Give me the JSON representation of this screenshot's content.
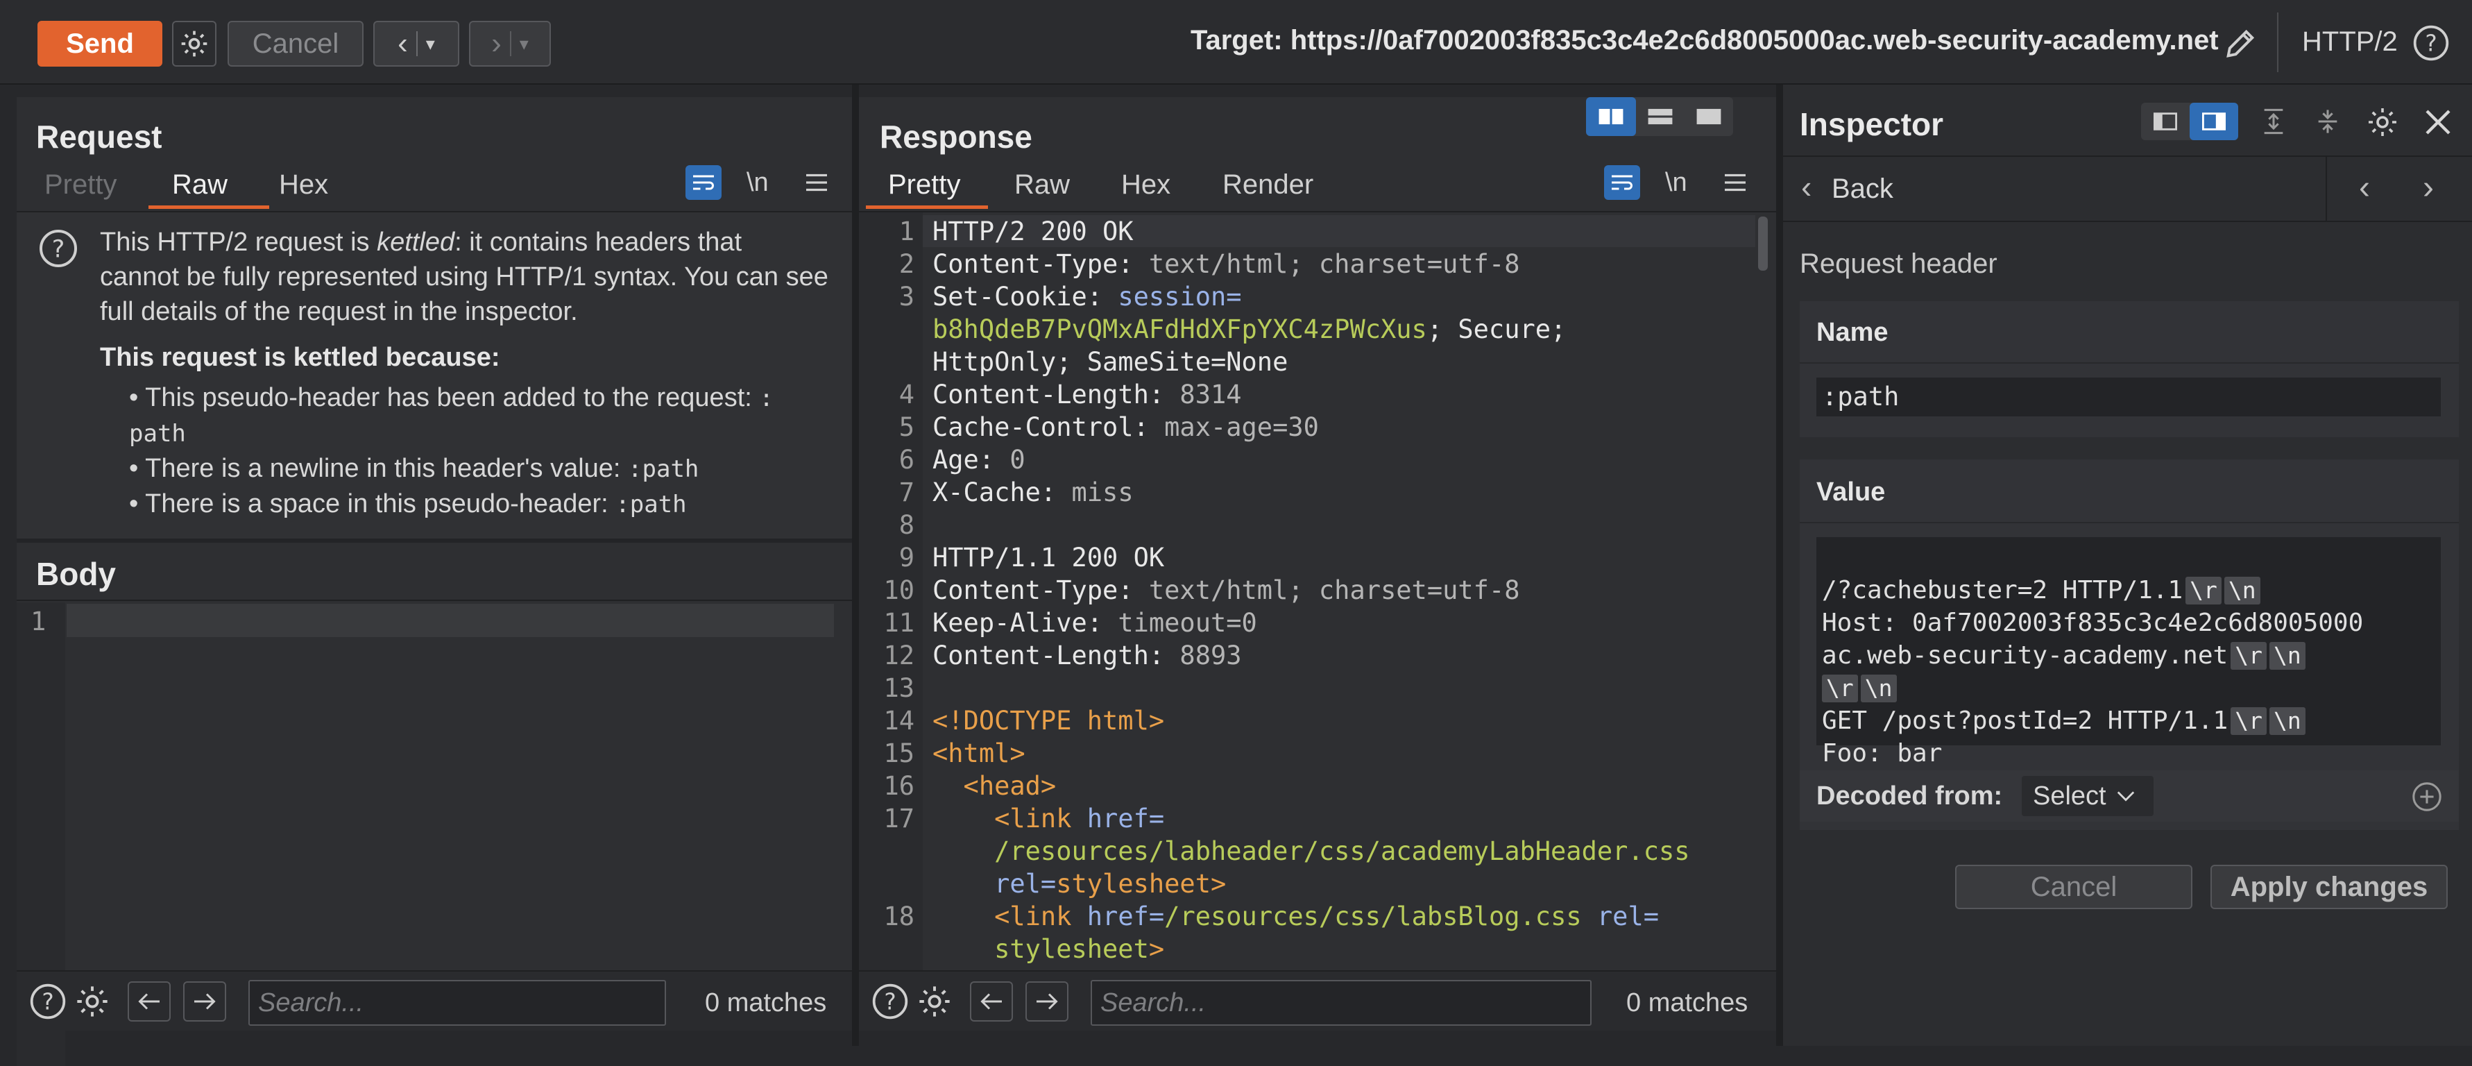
{
  "toolbar": {
    "send_label": "Send",
    "cancel_label": "Cancel",
    "target_label": "Target: https://0af7002003f835c3c4e2c6d8005000ac.web-security-academy.net",
    "protocol_label": "HTTP/2"
  },
  "request": {
    "title": "Request",
    "tabs": [
      "Pretty",
      "Raw",
      "Hex"
    ],
    "newline_toggle": "\\n",
    "kettled_message_1": "This HTTP/2 request is ",
    "kettled_word": "kettled",
    "kettled_message_2": ": it contains headers that",
    "kettled_message_line2": "cannot be fully represented using HTTP/1 syntax. You can see",
    "kettled_message_line3": "full details of the request in the inspector.",
    "kettled_because": "This request is kettled because:",
    "reason_1a": "• This pseudo-header has been added to the request: ",
    "reason_1b": ":",
    "reason_1c": "path",
    "reason_2": "• There is a newline in this header's value: ",
    "reason_2_code": ":path",
    "reason_3": "• There is a space in this pseudo-header: ",
    "reason_3_code": ":path",
    "body_title": "Body",
    "body_line": "1",
    "search_placeholder": "Search...",
    "matches": "0 matches"
  },
  "response": {
    "title": "Response",
    "tabs": [
      "Pretty",
      "Raw",
      "Hex",
      "Render"
    ],
    "newline_toggle": "\\n",
    "search_placeholder": "Search...",
    "matches": "0 matches",
    "lines": [
      {
        "n": "1",
        "k": "HTTP/2 200 OK",
        "v": ""
      },
      {
        "n": "2",
        "k": "Content-Type:",
        "v": " text/html; charset=utf-8"
      },
      {
        "n": "3",
        "k": "Set-Cookie:",
        "v": " session="
      },
      {
        "n": "",
        "k": "",
        "v": "b8hQdeB7PvQMxAFdHdXFpYXC4zPWcXus",
        "v2": "; Secure;"
      },
      {
        "n": "",
        "k": "HttpOnly; SameSite=None",
        "v": ""
      },
      {
        "n": "4",
        "k": "Content-Length:",
        "v": " 8314"
      },
      {
        "n": "5",
        "k": "Cache-Control:",
        "v": " max-age=30"
      },
      {
        "n": "6",
        "k": "Age:",
        "v": " 0"
      },
      {
        "n": "7",
        "k": "X-Cache:",
        "v": " miss"
      },
      {
        "n": "8",
        "k": "",
        "v": ""
      },
      {
        "n": "9",
        "k": "HTTP/1.1 200 OK",
        "v": ""
      },
      {
        "n": "10",
        "k": "Content-Type:",
        "v": " text/html; charset=utf-8"
      },
      {
        "n": "11",
        "k": "Keep-Alive:",
        "v": " timeout=0"
      },
      {
        "n": "12",
        "k": "Content-Length:",
        "v": " 8893"
      },
      {
        "n": "13",
        "k": "",
        "v": ""
      },
      {
        "n": "14",
        "k": "<!DOCTYPE html>",
        "v": ""
      },
      {
        "n": "15",
        "k": "<html>",
        "v": ""
      },
      {
        "n": "16",
        "k": "  <head>",
        "v": ""
      },
      {
        "n": "17",
        "k": "    <link href=",
        "v": ""
      },
      {
        "n": "",
        "k": "",
        "v": "    /resources/labheader/css/academyLabHeader.css"
      },
      {
        "n": "",
        "k": "    rel=stylesheet>",
        "v": ""
      },
      {
        "n": "18",
        "k": "    <link href=",
        "v": "/resources/css/labsBlog.css",
        "v2": " rel="
      },
      {
        "n": "",
        "k": "",
        "v": "    stylesheet",
        "v2": ">"
      }
    ]
  },
  "inspector": {
    "title": "Inspector",
    "back_label": "Back",
    "section_label": "Request header",
    "name_label": "Name",
    "name_value": ":path",
    "value_label": "Value",
    "value_lines": [
      "/?cachebuster=2 HTTP/1.1",
      "Host: 0af7002003f835c3c4e2c6d8005000",
      "ac.web-security-academy.net",
      "",
      "GET /post?postId=2 HTTP/1.1",
      "Foo: bar"
    ],
    "escape_r": "\\r",
    "escape_n": "\\n",
    "decoded_from_label": "Decoded from:",
    "decoded_select": "Select",
    "cancel_label": "Cancel",
    "apply_label": "Apply changes"
  },
  "colors": {
    "accent": "#e2632e",
    "toggle_blue": "#2f6db5"
  }
}
